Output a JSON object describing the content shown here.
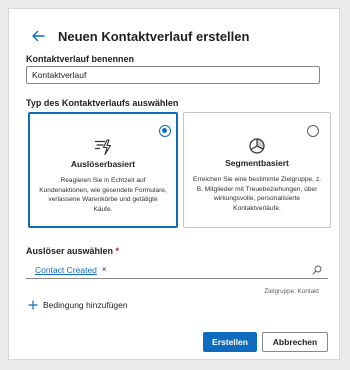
{
  "header": {
    "title": "Neuen Kontaktverlauf erstellen",
    "back_icon": "back-arrow-icon"
  },
  "name_section": {
    "label": "Kontaktverlauf benennen",
    "value": "Kontaktverlauf"
  },
  "type_section": {
    "label": "Typ des Kontaktverlaufs auswählen",
    "options": [
      {
        "title": "Auslöserbasiert",
        "description": "Reagieren Sie in Echtzeit auf Kundenaktionen, wie gesendete Formulare, verlassene Warenkörbe und getätigte Käufe.",
        "icon": "trigger-lightning-icon",
        "selected": true
      },
      {
        "title": "Segmentbasiert",
        "description": "Erreichen Sie eine bestimmte Zielgruppe, z. B. Mitglieder mit Treuebeziehungen, über wirkungsvolle, personalisierte Kontaktverläufe.",
        "icon": "segment-pie-icon",
        "selected": false
      }
    ]
  },
  "trigger_section": {
    "label": "Auslöser auswählen",
    "required_mark": "*",
    "tag": "Contact Created",
    "remove_symbol": "×",
    "hint": "Zielgruppe: Kontakt"
  },
  "add_condition": {
    "label": "Bedingung hinzufügen"
  },
  "buttons": {
    "create": "Erstellen",
    "cancel": "Abbrechen"
  },
  "colors": {
    "accent": "#0f6cbd",
    "border": "#8a8886",
    "background": "#ebebeb"
  }
}
